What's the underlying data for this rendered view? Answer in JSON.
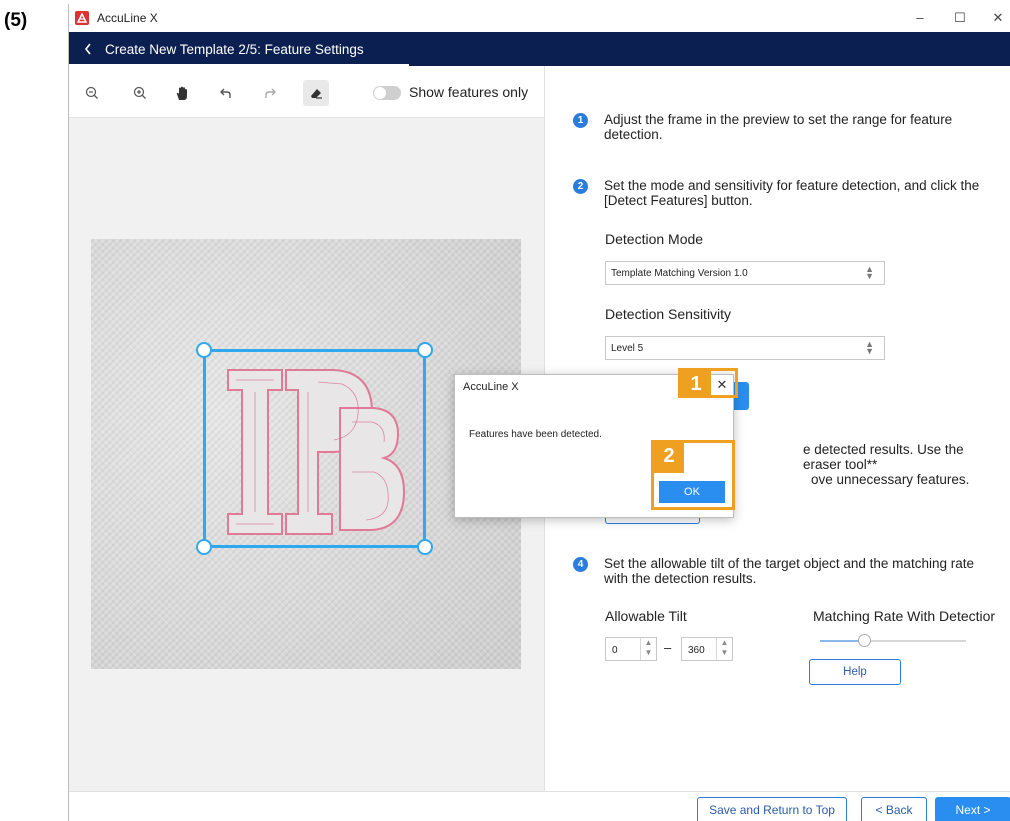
{
  "figure": {
    "step_label": "(5)"
  },
  "window": {
    "title": "AccuLine X",
    "controls": {
      "minimize": "–",
      "maximize": "☐",
      "close": "✕"
    }
  },
  "header": {
    "title": "Create New Template 2/5: Feature Settings"
  },
  "toolbar": {
    "tools": [
      "zoom-out-icon",
      "zoom-in-icon",
      "hand-icon",
      "undo-icon",
      "redo-icon",
      "eraser-icon"
    ],
    "toggle_label": "Show features only"
  },
  "steps": [
    {
      "num": "1",
      "text": "Adjust the frame in the preview to set the range for feature detection."
    },
    {
      "num": "2",
      "text": "Set the mode and sensitivity for feature detection, and click the [Detect Features] button."
    },
    {
      "num": "3",
      "text": "e detected results. Use the eraser tool**",
      "text2": "ove unnecessary features."
    },
    {
      "num": "4",
      "text": "Set the allowable tilt of the target object and the matching rate with the detection results."
    }
  ],
  "detection": {
    "mode_label": "Detection Mode",
    "mode_value": "Template Matching Version 1.0",
    "sensitivity_label": "Detection Sensitivity",
    "sensitivity_value": "Level 5"
  },
  "tilt": {
    "label": "Allowable Tilt",
    "min": "0",
    "max": "360",
    "dash": "–"
  },
  "matching": {
    "label": "Matching Rate With Detectior",
    "slider_fraction": 0.3
  },
  "help_label": "Help",
  "bottom": {
    "save_label": "Save and Return to Top",
    "back_label": "< Back",
    "next_label": "Next >"
  },
  "dialog": {
    "title": "AccuLine X",
    "message": "Features have been detected.",
    "close": "✕",
    "ok_label": "OK",
    "callout_1": "1",
    "callout_2": "2"
  },
  "colors": {
    "header_bg": "#0b2050",
    "accent": "#2a8ef0",
    "callout": "#f0a020",
    "frame": "#30a8ee"
  }
}
